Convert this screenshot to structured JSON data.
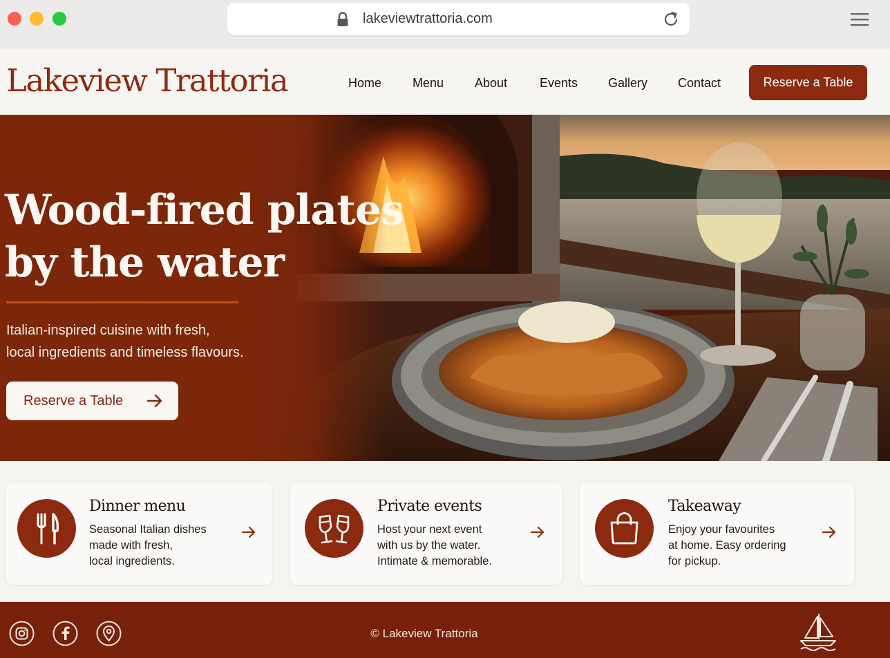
{
  "browser": {
    "url": "lakeviewtrattoria.com",
    "icons": [
      "lock-icon",
      "reload-icon",
      "hamburger-menu-icon"
    ]
  },
  "header": {
    "logo": "Lakeview Trattoria",
    "nav": [
      "Home",
      "Menu",
      "About",
      "Events",
      "Gallery",
      "Contact"
    ],
    "cta": "Reserve a Table"
  },
  "hero": {
    "title_line1": "Wood-fired plates",
    "title_line2": "by the water",
    "subtitle_line1": "Italian-inspired cuisine with fresh,",
    "subtitle_line2": "local ingredients and timeless flavours.",
    "cta": "Reserve a Table",
    "cta_icon": "arrow-right-icon"
  },
  "cards": [
    {
      "title": "Dinner menu",
      "lines": [
        "Seasonal Italian dishes",
        "made with fresh,",
        "local ingredients."
      ],
      "icon": "fork-knife-icon"
    },
    {
      "title": "Private events",
      "lines": [
        "Host your next event",
        "with us by the water.",
        "Intimate & memorable."
      ],
      "icon": "wine-glasses-icon"
    },
    {
      "title": "Takeaway",
      "lines": [
        "Enjoy your favourites",
        "at home. Easy ordering",
        "for pickup."
      ],
      "icon": "shopping-bag-icon"
    }
  ],
  "footer": {
    "copyright": "© Lakeview Trattoria",
    "social": [
      "instagram-icon",
      "facebook-icon",
      "map-pin-icon"
    ],
    "logo_icon": "sailboat-icon"
  },
  "colors": {
    "brand": "#8c2a10",
    "footer": "#78210a",
    "cream": "#fbf7f2"
  }
}
